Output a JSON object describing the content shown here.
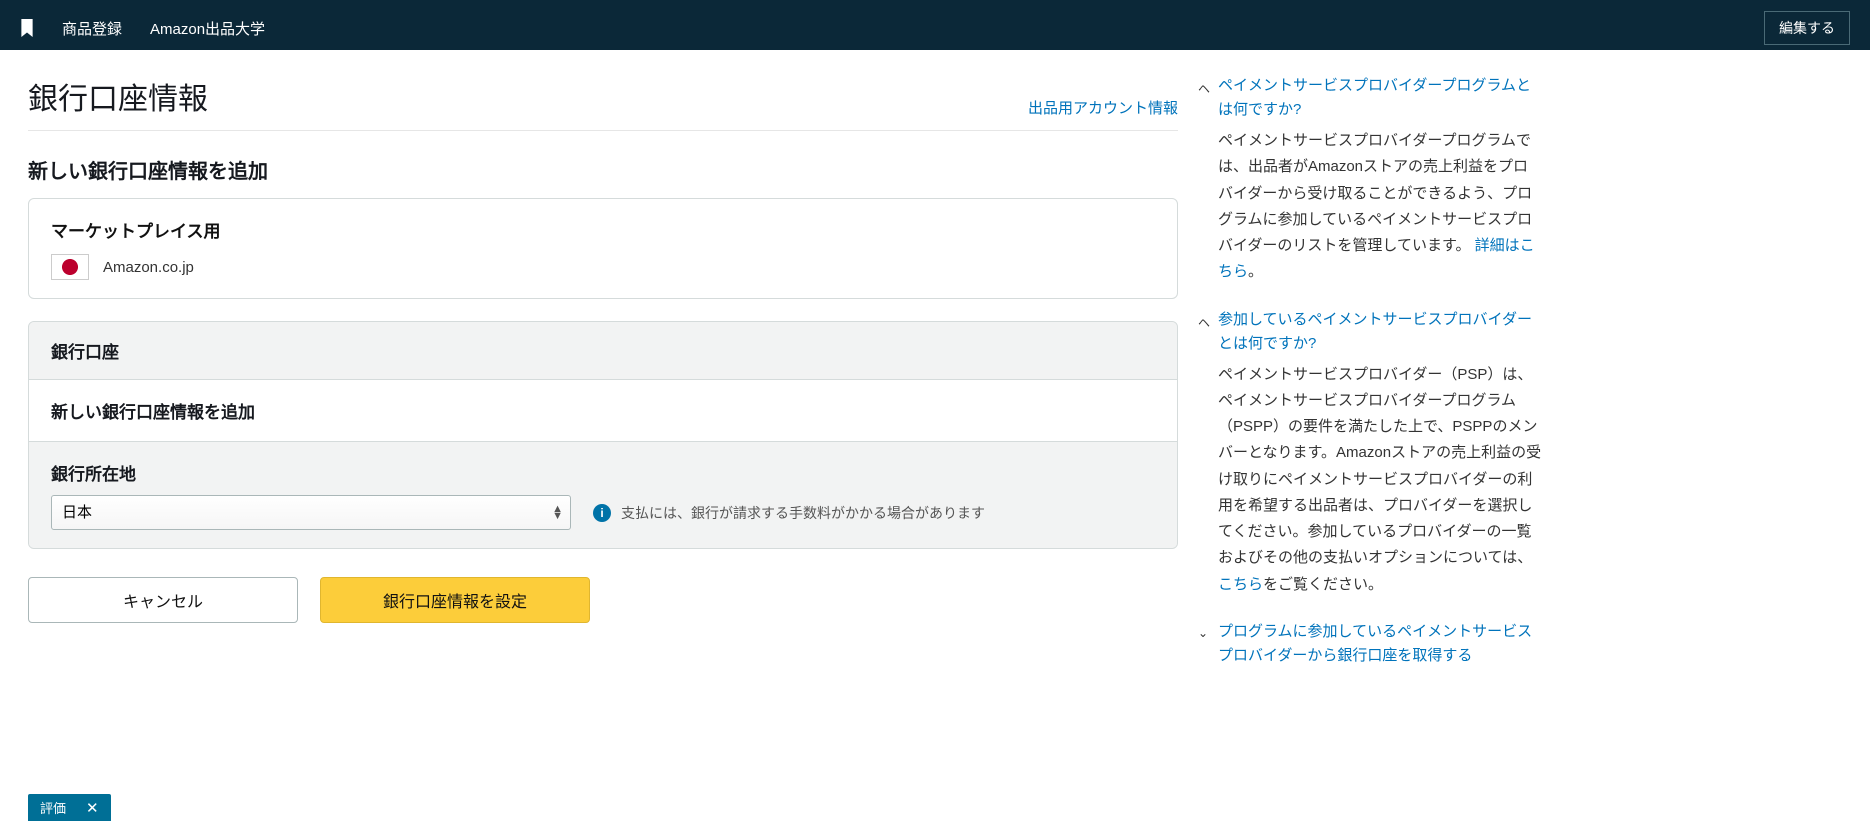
{
  "topbar": {
    "nav": {
      "item1": "商品登録",
      "item2": "Amazon出品大学"
    },
    "edit_label": "編集する"
  },
  "page": {
    "title": "銀行口座情報",
    "head_link": "出品用アカウント情報",
    "section_add_new": "新しい銀行口座情報を追加"
  },
  "marketplace": {
    "label": "マーケットプレイス用",
    "name": "Amazon.co.jp"
  },
  "form": {
    "section_header": "銀行口座",
    "add_new_label": "新しい銀行口座情報を追加",
    "bank_location_label": "銀行所在地",
    "bank_location_value": "日本",
    "fee_note": "支払には、銀行が請求する手数料がかかる場合があります"
  },
  "actions": {
    "cancel": "キャンセル",
    "submit": "銀行口座情報を設定"
  },
  "sidebar": {
    "items": [
      {
        "title": "ペイメントサービスプロバイダープログラムとは何ですか?",
        "desc_pre": "ペイメントサービスプロバイダープログラムでは、出品者がAmazonストアの売上利益をプロバイダーから受け取ることができるよう、プログラムに参加しているペイメントサービスプロバイダーのリストを管理しています。 ",
        "link": "詳細はこちら",
        "desc_post": "。"
      },
      {
        "title": "参加しているペイメントサービスプロバイダーとは何ですか?",
        "desc_pre": "ペイメントサービスプロバイダー（PSP）は、ペイメントサービスプロバイダープログラム（PSPP）の要件を満たした上で、PSPPのメンバーとなります。Amazonストアの売上利益の受け取りにペイメントサービスプロバイダーの利用を希望する出品者は、プロバイダーを選択してください。参加しているプロバイダーの一覧およびその他の支払いオプションについては、",
        "link": "こちら",
        "desc_post": "をご覧ください。"
      },
      {
        "title": "プログラムに参加しているペイメントサービスプロバイダーから銀行口座を取得する",
        "desc_pre": "",
        "link": "",
        "desc_post": ""
      }
    ]
  },
  "rating": {
    "label": "評価"
  }
}
